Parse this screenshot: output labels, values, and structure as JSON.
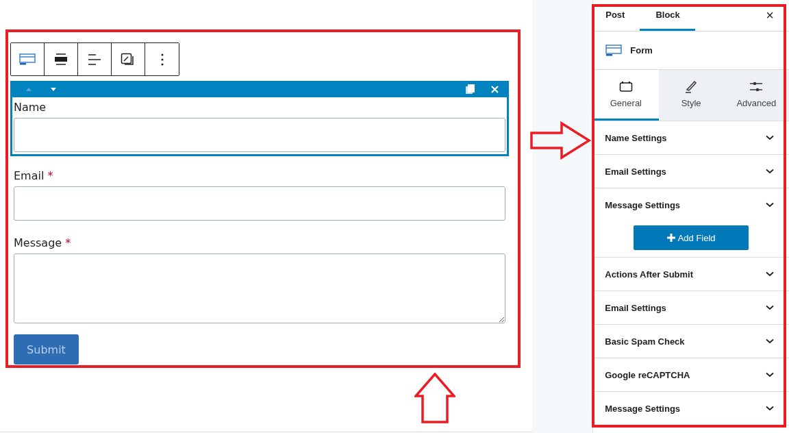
{
  "editor": {
    "toolbar": [
      {
        "kind": "form"
      },
      {
        "kind": "wide"
      },
      {
        "kind": "align"
      },
      {
        "kind": "edit"
      },
      {
        "kind": "more"
      }
    ],
    "fields": [
      {
        "label": "Name",
        "required": false,
        "kind": "input",
        "selected": true
      },
      {
        "label": "Email",
        "required": true,
        "kind": "input",
        "selected": false
      },
      {
        "label": "Message",
        "required": true,
        "kind": "textarea",
        "selected": false
      }
    ],
    "required_mark": "*",
    "submit": "Submit"
  },
  "sidebar": {
    "tabs": [
      {
        "label": "Post",
        "selected": false
      },
      {
        "label": "Block",
        "selected": true
      }
    ],
    "close": "×",
    "block": {
      "name": "Form"
    },
    "panel_tabs": [
      {
        "label": "General",
        "kind": "general",
        "selected": true
      },
      {
        "label": "Style",
        "kind": "style",
        "selected": false
      },
      {
        "label": "Advanced",
        "kind": "advanced",
        "selected": false
      }
    ],
    "sections": [
      {
        "title": "Name Settings"
      },
      {
        "title": "Email Settings"
      },
      {
        "title": "Message Settings",
        "button": "Add Field"
      },
      {
        "title": "Actions After Submit"
      },
      {
        "title": "Email Settings"
      },
      {
        "title": "Basic Spam Check"
      },
      {
        "title": "Google reCAPTCHA"
      },
      {
        "title": "Message Settings"
      }
    ]
  }
}
